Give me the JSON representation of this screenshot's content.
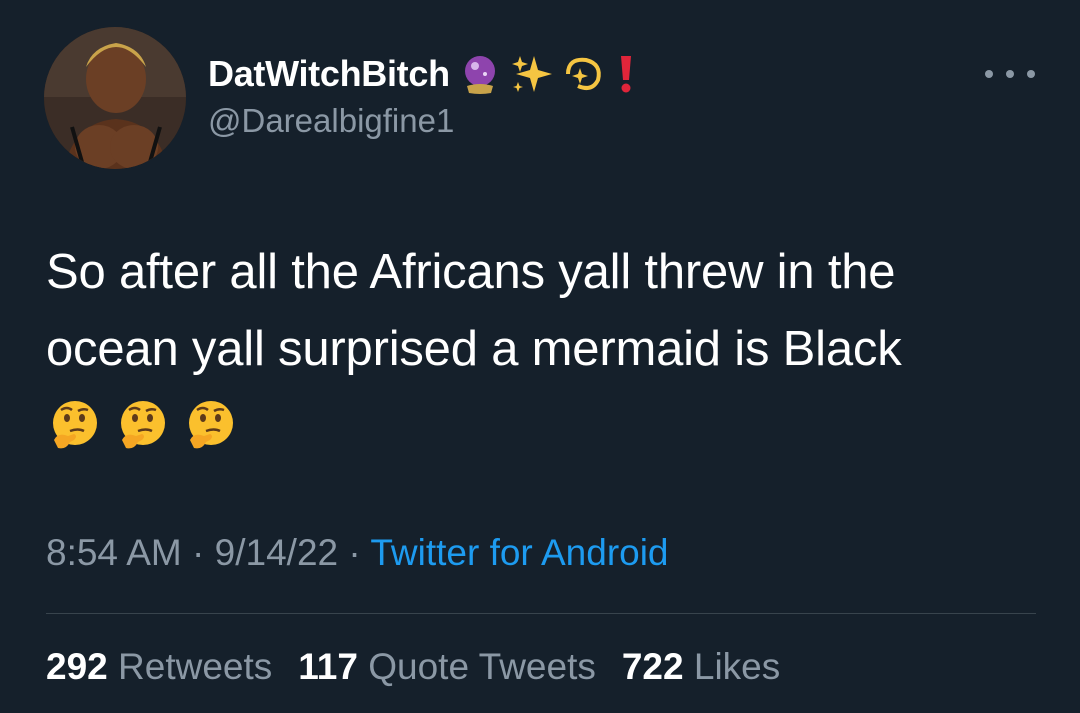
{
  "user": {
    "display_name": "DatWitchBitch",
    "handle": "@Darealbigfine1",
    "name_emojis": [
      "crystal-ball-icon",
      "sparkles-icon",
      "dizzy-icon",
      "exclamation-icon"
    ]
  },
  "tweet": {
    "text": "So after all the Africans yall threw in the ocean yall surprised a mermaid is Black",
    "trailing_emojis": [
      "thinking-face-icon",
      "thinking-face-icon",
      "thinking-face-icon"
    ]
  },
  "meta": {
    "time": "8:54 AM",
    "sep1": " · ",
    "date": "9/14/22",
    "sep2": " · ",
    "source": "Twitter for Android"
  },
  "stats": {
    "retweets_count": "292",
    "retweets_label": "Retweets",
    "quotes_count": "117",
    "quotes_label": "Quote Tweets",
    "likes_count": "722",
    "likes_label": "Likes"
  },
  "colors": {
    "background": "#15202b",
    "text": "#ffffff",
    "secondary": "#8b98a5",
    "link": "#1d9bf0",
    "divider": "#38444d"
  }
}
